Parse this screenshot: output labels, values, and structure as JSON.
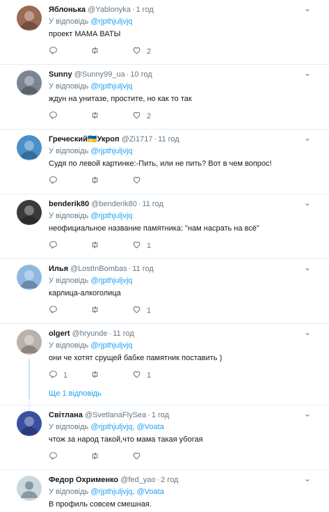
{
  "reply_prefix": "У відповідь",
  "caret_glyph": "⌄",
  "tweets": [
    {
      "name": "Яблонька",
      "handle": "@Yablonyka",
      "time": "1 год",
      "mentions": "@rjpthjuljvjq",
      "text": "проект МАМА ВАТЫ",
      "counts": {
        "reply": "",
        "retweet": "",
        "like": "2"
      },
      "avatar_color": "#9a6a55"
    },
    {
      "name": "Sunny",
      "handle": "@Sunny99_ua",
      "time": "10 год",
      "mentions": "@rjpthjuljvjq",
      "text": "ждун на унитазе, простите, но как то так",
      "counts": {
        "reply": "",
        "retweet": "",
        "like": "2"
      },
      "avatar_color": "#7a8591"
    },
    {
      "name": "Греческий🇺🇦Укроп",
      "handle": "@Zi1717",
      "time": "11 год",
      "mentions": "@rjpthjuljvjq",
      "text": "Судя по левой картинке:-Пить, или не пить? Вот в чем вопрос!",
      "counts": {
        "reply": "",
        "retweet": "",
        "like": ""
      },
      "avatar_color": "#4a90c8"
    },
    {
      "name": "benderik80",
      "handle": "@benderik80",
      "time": "11 год",
      "mentions": "@rjpthjuljvjq",
      "text": "неофициальное название памятника: \"нам насрать на всё\"",
      "counts": {
        "reply": "",
        "retweet": "",
        "like": "1"
      },
      "avatar_color": "#3a3a3a"
    },
    {
      "name": "Илья",
      "handle": "@LostInBombas",
      "time": "11 год",
      "mentions": "@rjpthjuljvjq",
      "text": "карлица-алкоголица",
      "counts": {
        "reply": "",
        "retweet": "",
        "like": "1"
      },
      "avatar_color": "#8fb7e0"
    },
    {
      "name": "olgert",
      "handle": "@hryunde",
      "time": "11 год",
      "mentions": "@rjpthjuljvjq",
      "text": "они че хотят срущей бабке памятник поставить )",
      "counts": {
        "reply": "1",
        "retweet": "",
        "like": "1"
      },
      "avatar_color": "#b9b2aa",
      "show_more": "Ще 1 відповідь"
    },
    {
      "name": "Світлана",
      "handle": "@SvetlanaFlySea",
      "time": "1 год",
      "mentions": "@rjpthjuljvjq, @Voata",
      "text": "чтож за народ такой,что мама такая убогая",
      "counts": {
        "reply": "",
        "retweet": "",
        "like": ""
      },
      "avatar_color": "#3b4fa0"
    },
    {
      "name": "Федор Охрименко",
      "handle": "@fed_yao",
      "time": "2 год",
      "mentions": "@rjpthjuljvjq, @Voata",
      "text": "В профиль совсем смешная.",
      "counts": {
        "reply": "",
        "retweet": "",
        "like": ""
      },
      "avatar_color": "#ccd6dd"
    }
  ]
}
